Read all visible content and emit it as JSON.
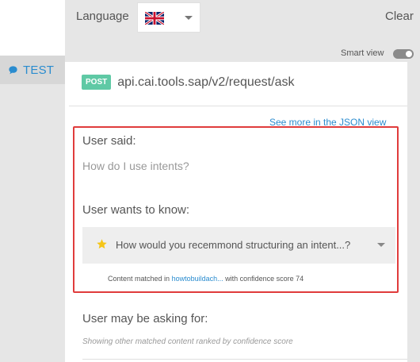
{
  "header": {
    "language_label": "Language",
    "language_flag": "uk-flag-icon",
    "clear_label": "Clear",
    "smart_view_label": "Smart view",
    "smart_view_on": true
  },
  "sidebar": {
    "tab_label": "TEST",
    "tab_icon": "chat-bubble-icon"
  },
  "request": {
    "method": "POST",
    "endpoint": "api.cai.tools.sap/v2/request/ask",
    "json_link": "See more in the JSON view"
  },
  "analysis": {
    "user_said_label": "User said:",
    "utterance": "How do I use intents?",
    "wants_label": "User wants to know:",
    "answer": "How would you recemmond structuring an intent...?",
    "answer_icon": "star-icon",
    "match_prefix": "Content matched in ",
    "match_source": "howtobuildach...",
    "match_suffix": " with confidence score 74",
    "maybe_label": "User may be asking for:",
    "maybe_sub": "Showing other matched content ranked by confidence score"
  },
  "colors": {
    "accent": "#2a8ccf",
    "post_badge": "#5fc9a5",
    "highlight_frame": "#e03c3c",
    "panel_gray": "#e6e6e6"
  }
}
